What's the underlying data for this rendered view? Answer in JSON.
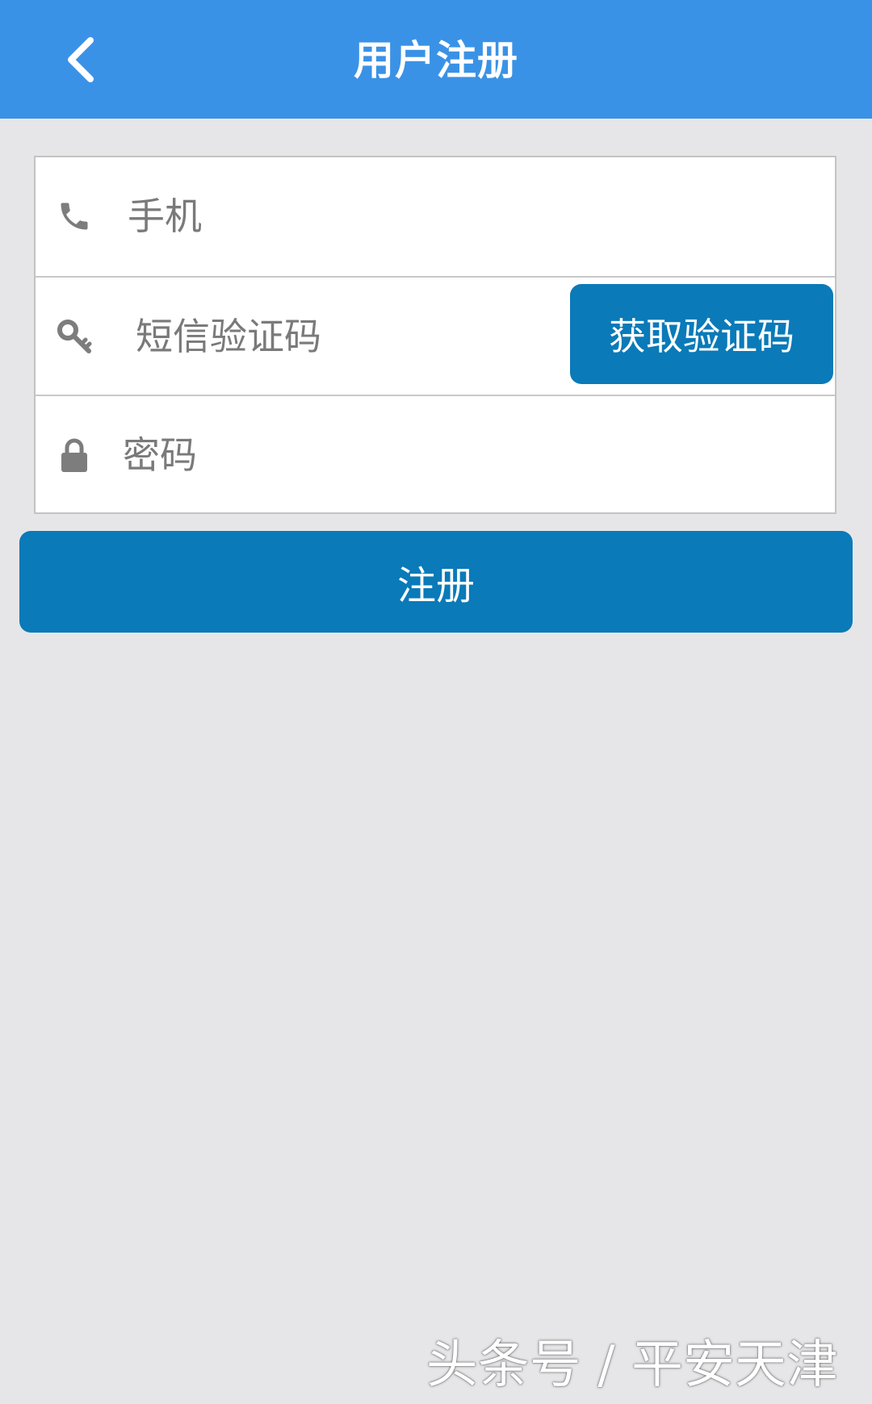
{
  "header": {
    "title": "用户注册",
    "back_icon": "chevron-left-icon"
  },
  "form": {
    "phone": {
      "icon": "phone-icon",
      "placeholder": "手机",
      "value": ""
    },
    "sms_code": {
      "icon": "key-icon",
      "placeholder": "短信验证码",
      "value": "",
      "button_label": "获取验证码"
    },
    "password": {
      "icon": "lock-icon",
      "placeholder": "密码",
      "value": ""
    }
  },
  "register_button": {
    "label": "注册"
  },
  "watermark": {
    "text": "头条号 / 平安天津"
  },
  "colors": {
    "header_bg": "#3a92e6",
    "button_bg": "#0a7ab8",
    "page_bg": "#e6e6e8",
    "icon_gray": "#7d7d7d"
  }
}
